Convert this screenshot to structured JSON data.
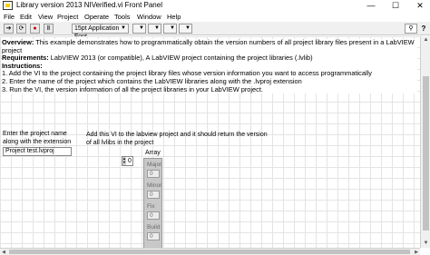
{
  "window": {
    "title": "Library version 2013 NIVerified.vi Front Panel",
    "minimize": "—",
    "maximize": "☐",
    "close": "✕"
  },
  "menu": {
    "items": [
      "File",
      "Edit",
      "View",
      "Project",
      "Operate",
      "Tools",
      "Window",
      "Help"
    ]
  },
  "toolbar": {
    "font_label": "15pt Application Font",
    "search_icon": "search-icon",
    "help_label": "?"
  },
  "description": {
    "overview_head": "Overview:",
    "overview_text": " This example demonstrates how to programmatically obtain the version numbers of all project library files present in a LabVIEW project",
    "requirements_head": "Requirements:",
    "requirements_text": " LabVIEW 2013 (or compatible), A LabVIEW project containing the project libraries (.lvlib)",
    "instructions_head": "Instructions:",
    "step1": "1. Add the VI to the project containing the project library files whose version information you want to access programmatically",
    "step2": "2. Enter the name of the project which contains the LabVIEW libraries along with the .lvproj extension",
    "step3": "3. Run the VI, the version information of all the project libraries in your LabVIEW project."
  },
  "project_label": "Enter the project name along with the extension",
  "project_value": "Project test.lvproj",
  "add_label": "Add this VI to the labview project and it should return the version of all lvlibs in the project",
  "array": {
    "label": "Array",
    "index_value": "0",
    "fields": [
      {
        "label": "Major",
        "value": "0"
      },
      {
        "label": "Minor",
        "value": "0"
      },
      {
        "label": "Fix",
        "value": "0"
      },
      {
        "label": "Build",
        "value": "0"
      }
    ]
  }
}
